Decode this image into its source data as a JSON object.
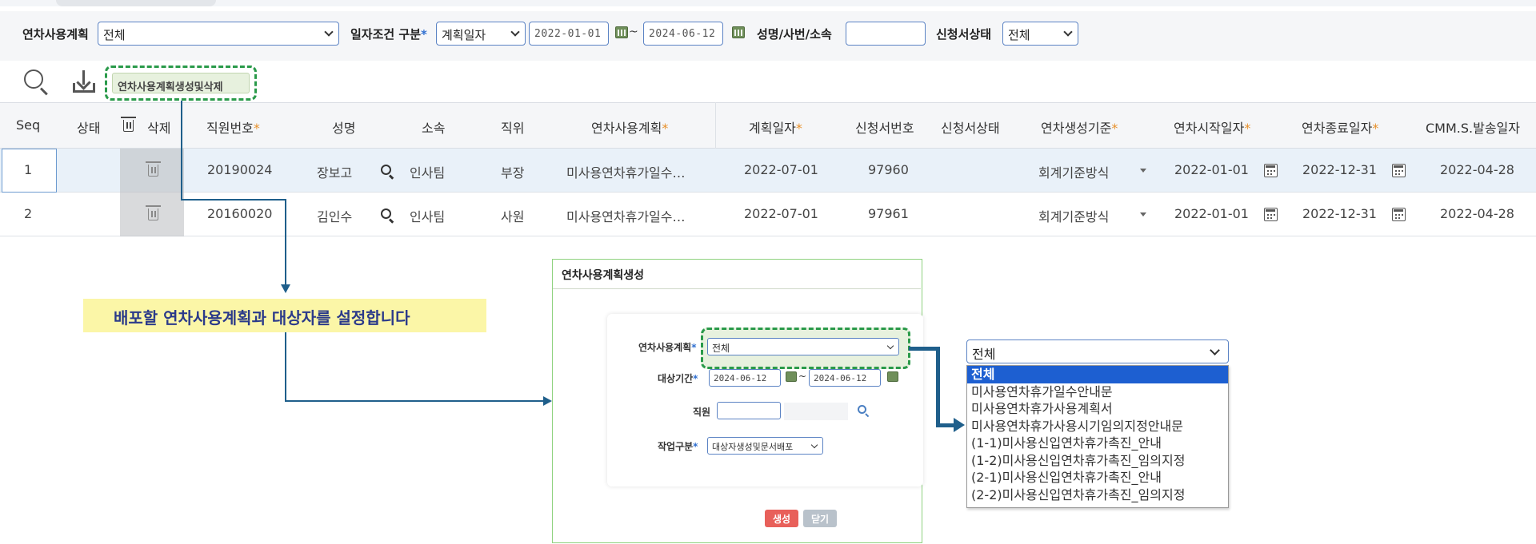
{
  "filters": {
    "plan_label": "연차사용계획",
    "plan_value": "전체",
    "date_cond_label": "일자조건 구분",
    "date_cond_req": "*",
    "date_cond_value": "계획일자",
    "date_from": "2022-01-01",
    "date_to": "2024-06-12",
    "tilde": "~",
    "name_label": "성명/사번/소속",
    "name_value": "",
    "status_label": "신청서상태",
    "status_value": "전체"
  },
  "toolbar": {
    "action_label": "연차사용계획생성및삭제"
  },
  "grid": {
    "headers": [
      {
        "label": "Seq",
        "star": ""
      },
      {
        "label": "상태",
        "star": ""
      },
      {
        "label": "삭제",
        "star": ""
      },
      {
        "label": "직원번호",
        "star": "*"
      },
      {
        "label": "성명",
        "star": ""
      },
      {
        "label": "소속",
        "star": ""
      },
      {
        "label": "직위",
        "star": ""
      },
      {
        "label": "연차사용계획",
        "star": "*"
      },
      {
        "label": "계획일자",
        "star": "*"
      },
      {
        "label": "신청서번호",
        "star": ""
      },
      {
        "label": "신청서상태",
        "star": ""
      },
      {
        "label": "연차생성기준",
        "star": "*"
      },
      {
        "label": "연차시작일자",
        "star": "*"
      },
      {
        "label": "연차종료일자",
        "star": "*"
      },
      {
        "label": "CMM.S.발송일자",
        "star": ""
      }
    ],
    "rows": [
      {
        "seq": "1",
        "status": "",
        "emp_no": "20190024",
        "name": "장보고",
        "dept": "인사팀",
        "position": "부장",
        "plan": "미사용연차휴가일수…",
        "plan_date": "2022-07-01",
        "app_no": "97960",
        "app_status": "",
        "basis": "회계기준방식",
        "start": "2022-01-01",
        "end": "2022-12-31",
        "sent": "2022-04-28"
      },
      {
        "seq": "2",
        "status": "",
        "emp_no": "20160020",
        "name": "김인수",
        "dept": "인사팀",
        "position": "사원",
        "plan": "미사용연차휴가일수…",
        "plan_date": "2022-07-01",
        "app_no": "97961",
        "app_status": "",
        "basis": "회계기준방식",
        "start": "2022-01-01",
        "end": "2022-12-31",
        "sent": "2022-04-28"
      }
    ]
  },
  "callout": "배포할 연차사용계획과 대상자를 설정합니다",
  "dialog": {
    "title": "연차사용계획생성",
    "plan_label": "연차사용계획",
    "plan_value": "전체",
    "period_label": "대상기간",
    "period_from": "2024-06-12",
    "period_to": "2024-06-12",
    "employee_label": "직원",
    "employee_value": "",
    "work_label": "작업구분",
    "work_value": "대상자생성및문서배포",
    "req": "*",
    "tilde": "~",
    "generate_label": "생성",
    "close_label": "닫기"
  },
  "dropdown": {
    "selected": "전체",
    "options": [
      "전체",
      "미사용연차휴가일수안내문",
      "미사용연차휴가사용계획서",
      "미사용연차휴가사용시기임의지정안내문",
      "(1-1)미사용신입연차휴가촉진_안내",
      "(1-2)미사용신입연차휴가촉진_임의지정",
      "(2-1)미사용신입연차휴가촉진_안내",
      "(2-2)미사용신입연차휴가촉진_임의지정"
    ]
  },
  "colors": {
    "accent": "#1f5f8b",
    "dashed_highlight": "#2a9a4a",
    "selected_option": "#1d5fd1",
    "generate_button": "#e8605a"
  }
}
